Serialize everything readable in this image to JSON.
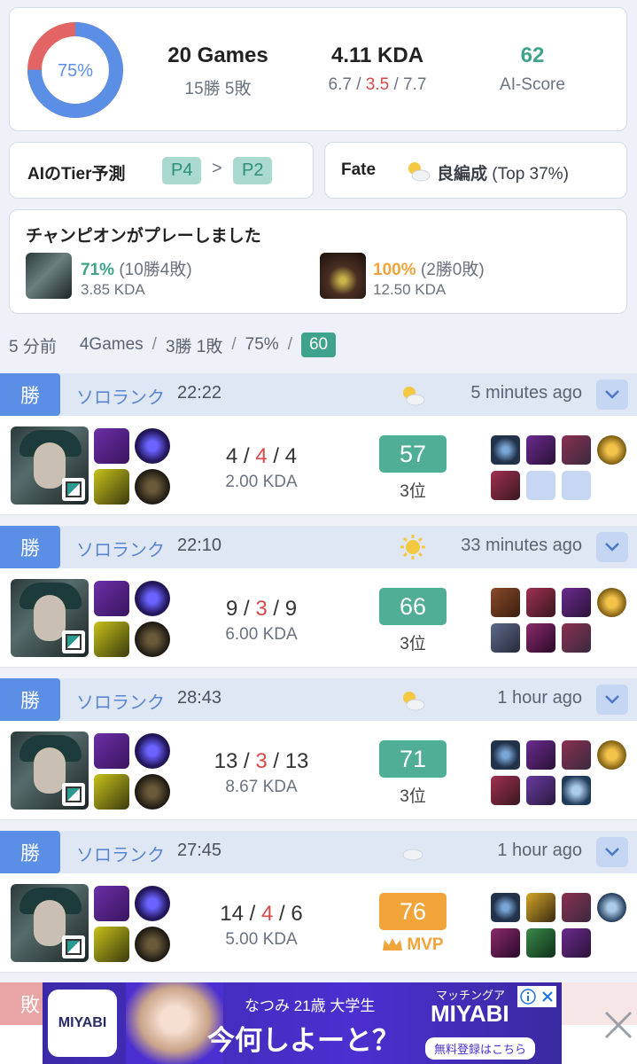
{
  "summary": {
    "winrate_label": "75%",
    "winrate": 0.75,
    "games_label": "20 Games",
    "record": "15勝 5敗",
    "kda_label": "4.11 KDA",
    "kills": "6.7",
    "deaths": "3.5",
    "assists": "7.7",
    "ai_score": "62",
    "ai_score_label": "AI-Score"
  },
  "tier": {
    "label": "AIのTier予測",
    "from": "P4",
    "arrow": ">",
    "to": "P2"
  },
  "fate": {
    "label": "Fate",
    "value": "良編成",
    "extra": "(Top 37%)"
  },
  "champions": {
    "title": "チャンピオンがプレーしました",
    "items": [
      {
        "winrate": "71%",
        "record": "(10勝4敗)",
        "kda": "3.85 KDA"
      },
      {
        "winrate": "100%",
        "record": "(2勝0敗)",
        "kda": "12.50 KDA"
      }
    ]
  },
  "recent": {
    "time": "5 分前",
    "games": "4Games",
    "record": "3勝 1敗",
    "winrate": "75%",
    "score": "60",
    "sep": "/"
  },
  "matches": [
    {
      "result": "勝",
      "queue": "ソロランク",
      "duration": "22:22",
      "ago": "5 minutes ago",
      "k": "4",
      "d": "4",
      "a": "4",
      "kda": "2.00 KDA",
      "score": "57",
      "rank": "3位"
    },
    {
      "result": "勝",
      "queue": "ソロランク",
      "duration": "22:10",
      "ago": "33 minutes ago",
      "k": "9",
      "d": "3",
      "a": "9",
      "kda": "6.00 KDA",
      "score": "66",
      "rank": "3位"
    },
    {
      "result": "勝",
      "queue": "ソロランク",
      "duration": "28:43",
      "ago": "1 hour ago",
      "k": "13",
      "d": "3",
      "a": "13",
      "kda": "8.67 KDA",
      "score": "71",
      "rank": "3位"
    },
    {
      "result": "勝",
      "queue": "ソロランク",
      "duration": "27:45",
      "ago": "1 hour ago",
      "k": "14",
      "d": "4",
      "a": "6",
      "kda": "5.00 KDA",
      "score": "76",
      "rank": "MVP"
    }
  ],
  "partial_match": {
    "result": "敗"
  },
  "ad": {
    "brand": "MIYABI",
    "line1": "なつみ 21歳 大学生",
    "line2": "今何しよーと？",
    "brand_small": "マッチングア",
    "brand_big": "MIYABI",
    "cta": "無料登録はこちら"
  },
  "colors": {
    "accent_blue": "#5b8fe6",
    "win_green": "#3ea38a",
    "loss_red": "#d44a4a",
    "mvp_orange": "#f0a43a"
  }
}
